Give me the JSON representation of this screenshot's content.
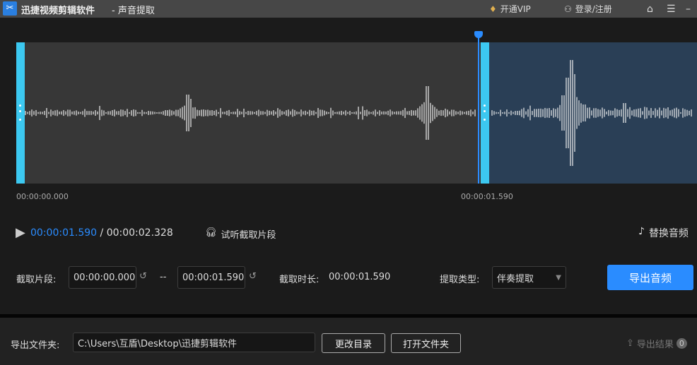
{
  "titlebar": {
    "app": "迅捷视频剪辑软件",
    "section": " - 声音提取",
    "vip": "开通VIP",
    "login": "登录/注册"
  },
  "timeline": {
    "start": "00:00:00.000",
    "cursor": "00:00:01.590"
  },
  "player": {
    "current": "00:00:01.590",
    "sep": " / ",
    "total": "00:00:02.328",
    "preview": "试听截取片段",
    "replace": "替换音频"
  },
  "clip": {
    "label": "截取片段:",
    "start": "00:00:00.000",
    "dash": "--",
    "end": "00:00:01.590",
    "duration_label": "截取时长:",
    "duration": "00:00:01.590",
    "type_label": "提取类型:",
    "type_value": "伴奏提取",
    "export": "导出音频"
  },
  "footer": {
    "folder_label": "导出文件夹:",
    "folder_path": "C:\\Users\\互盾\\Desktop\\迅捷剪辑软件",
    "change_dir": "更改目录",
    "open_folder": "打开文件夹",
    "results": "导出结果",
    "results_count": "0"
  },
  "colors": {
    "accent": "#2a8cff",
    "handle": "#3cc8f0",
    "selected_bg": "#373737",
    "unselected_bg": "#2a3f56"
  }
}
